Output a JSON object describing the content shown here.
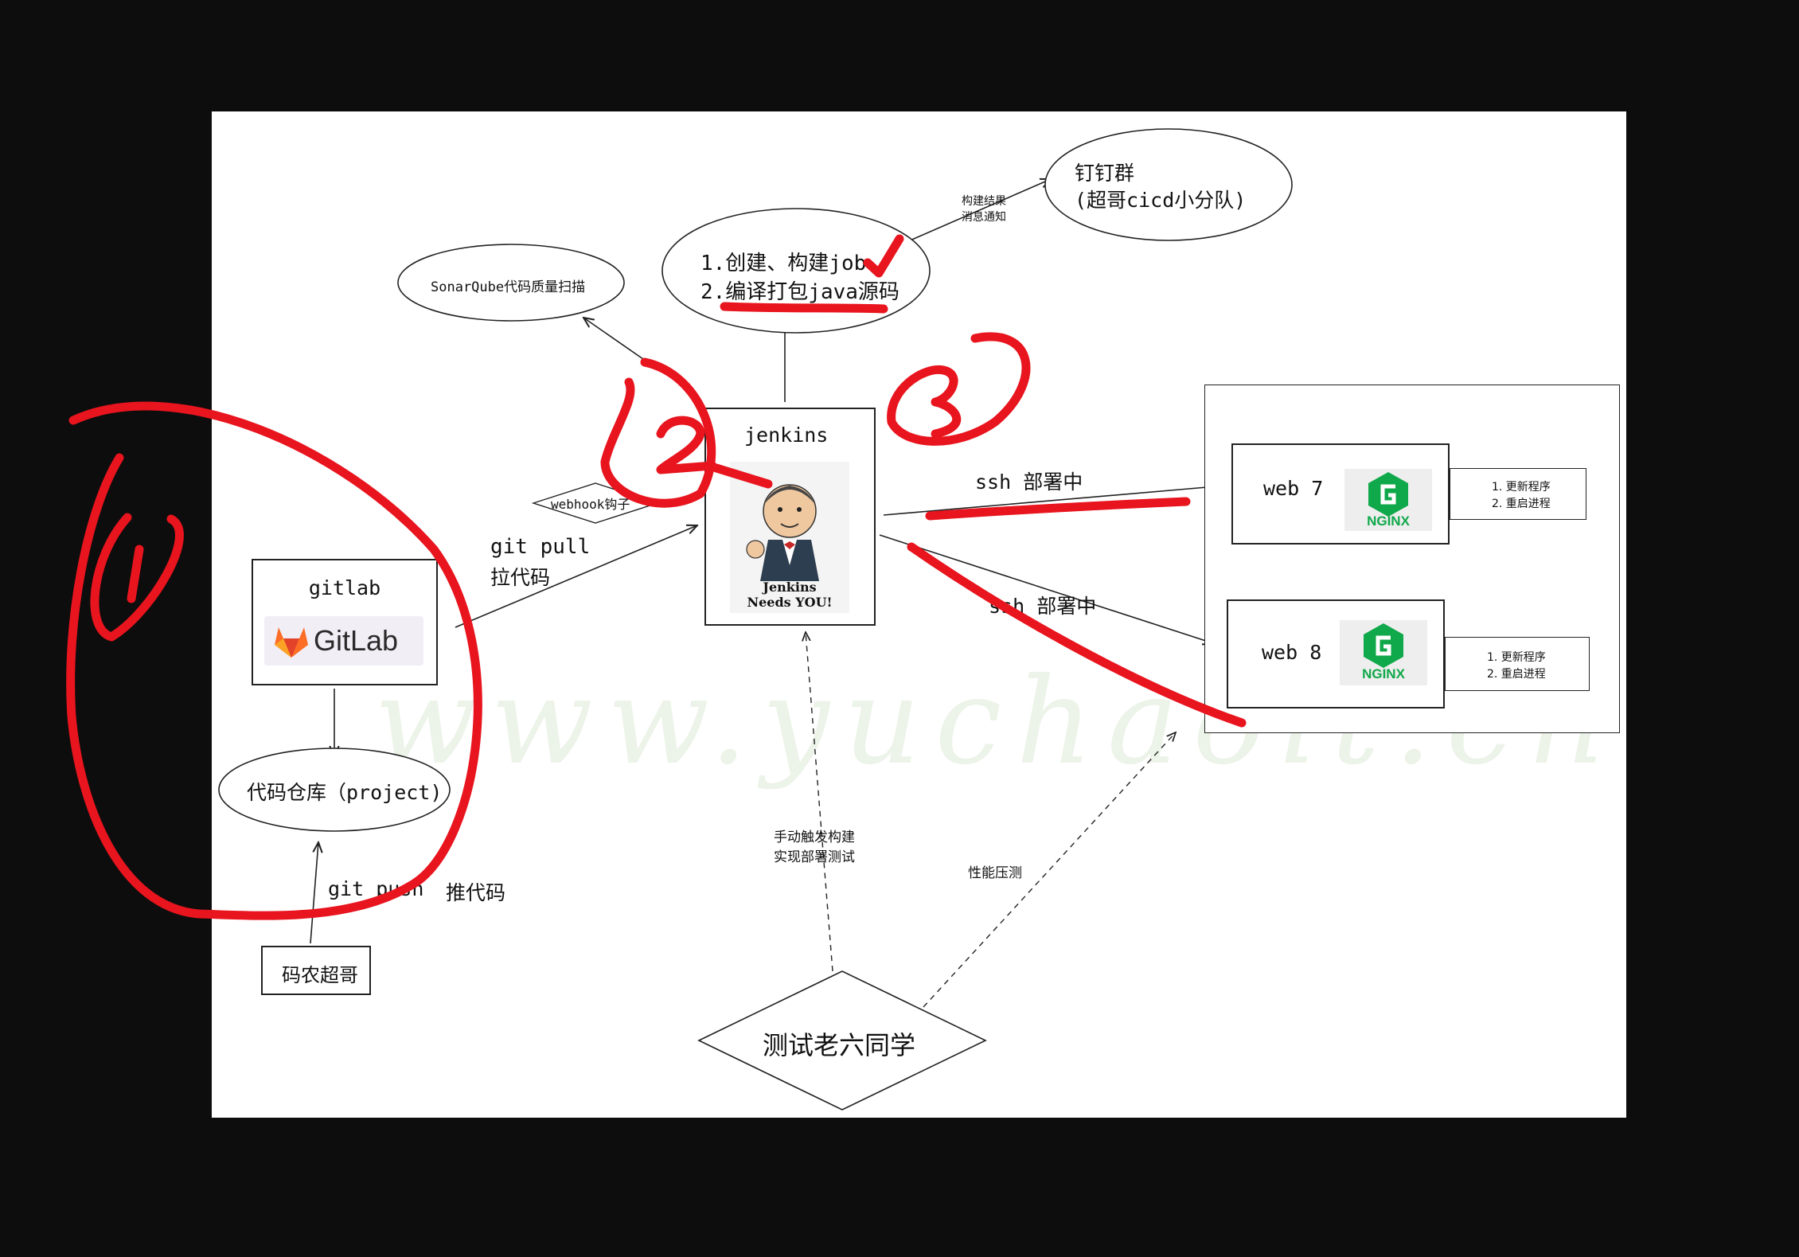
{
  "nodes": {
    "gitlab_title": "gitlab",
    "gitlab_logo_text": "GitLab",
    "repo": "代码仓库（project)",
    "coder": "码农超哥",
    "jenkins_title": "jenkins",
    "jenkins_caption_1": "Jenkins",
    "jenkins_caption_2": "Needs YOU!",
    "sonar": "SonarQube代码质量扫描",
    "build_line1": "1.创建、构建job",
    "build_line2": "2.编译打包java源码",
    "dingtalk_line1": "钉钉群",
    "dingtalk_line2": "(超哥cicd小分队)",
    "web7": "web 7",
    "web8": "web 8",
    "nginx_text": "NGINX",
    "web7_tasks": [
      "1. 更新程序",
      "2. 重启进程"
    ],
    "web8_tasks": [
      "1. 更新程序",
      "2. 重启进程"
    ],
    "tester": "测试老六同学"
  },
  "edges": {
    "git_pull_1": "git pull",
    "git_pull_2": "拉代码",
    "git_push_cmd": "git push",
    "git_push_desc": "推代码",
    "webhook": "webhook钩子",
    "notify_1": "构建结果",
    "notify_2": "消息通知",
    "ssh_deploy_1": "ssh 部署中",
    "ssh_deploy_2": "ssh 部署中",
    "manual_1": "手动触发构建",
    "manual_2": "实现部署测试",
    "perf": "性能压测"
  },
  "annotations": {
    "numbers": [
      "1",
      "2",
      "3"
    ],
    "color": "#e8141e"
  },
  "watermark": "www.yuchaoit.cn",
  "colors": {
    "background": "#0d0d0d",
    "canvas": "#ffffff",
    "nginx_green": "#0fa84a",
    "gitlab_orange": "#fc6d26"
  },
  "icons": [
    "gitlab-logo-icon",
    "jenkins-butler-icon",
    "nginx-logo-icon"
  ]
}
